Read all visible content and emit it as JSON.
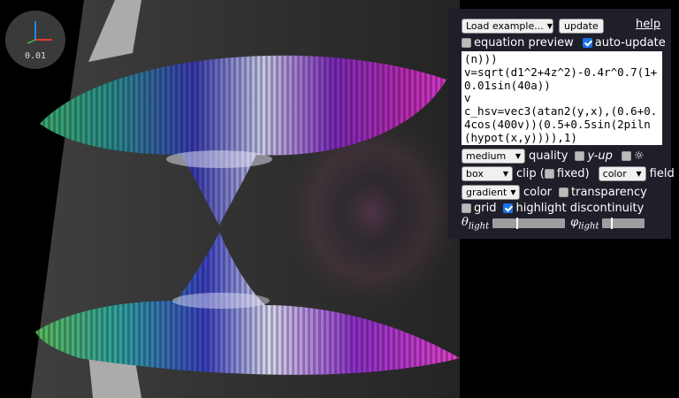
{
  "viewer": {
    "zoom_readout": "0.01",
    "axis_colors": {
      "x": "#e53935",
      "y": "#43a047",
      "z": "#1e88e5"
    }
  },
  "panel": {
    "examples_select": "Load example...",
    "update_button": "update",
    "help_link": "help",
    "equation_preview_label": "equation preview",
    "equation_preview_checked": false,
    "auto_update_label": "auto-update",
    "auto_update_checked": true,
    "equation_text": "(n)))\nv=sqrt(d1^2+4z^2)-0.4r^0.7(1+0.01sin(40a))\nv\nc_hsv=vec3(atan2(y,x),(0.6+0.4cos(400v))(0.5+0.5sin(2piln(hypot(x,y)))),1)",
    "quality_select": "medium",
    "quality_label": "quality",
    "y_up_label": "y-up",
    "y_up_checked": false,
    "light_icon": "sun-icon",
    "light_symbol": "☼",
    "light_checked": false,
    "clip_select": "box",
    "clip_label": "clip (",
    "fixed_label": "fixed)",
    "fixed_checked": false,
    "field_select": "color",
    "field_label": "field",
    "color_select": "gradient",
    "color_label": "color",
    "transparency_label": "transparency",
    "transparency_checked": false,
    "grid_label": "grid",
    "grid_checked": false,
    "highlight_label": "highlight discontinuity",
    "highlight_checked": true,
    "theta_symbol": "θ",
    "phi_symbol": "φ",
    "light_subscript": "light",
    "theta_value": 0.33,
    "phi_value": 0.2
  }
}
